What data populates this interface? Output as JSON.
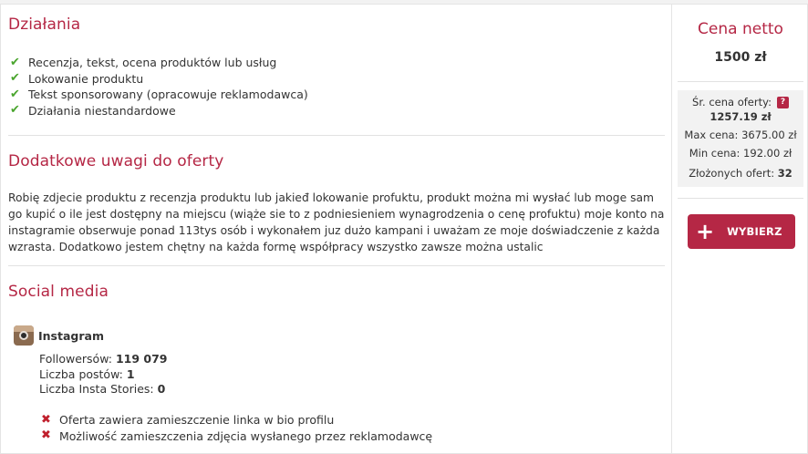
{
  "activities": {
    "title": "Działania",
    "items": [
      "Recenzja, tekst, ocena produktów lub usług",
      "Lokowanie produktu",
      "Tekst sponsorowany (opracowuje reklamodawca)",
      "Działania niestandardowe"
    ]
  },
  "notes": {
    "title": "Dodatkowe uwagi do oferty",
    "text": "Robię zdjecie produktu z recenzja produktu lub jakieđ lokowanie profuktu, produkt można mi wysłać lub moge sam go kupić o ile jest dostępny na miejscu (wiąże sie to z podniesieniem wynagrodzenia o cenę profuktu) moje konto na instagramie obserwuje ponad 113tys osób i  wykonałem juz dużo kampani i uważam ze moje doświadczenie z każda wzrasta. Dodatkowo jestem chętny na każda formę współpracy wszystko zawsze można ustalic"
  },
  "social": {
    "title": "Social media",
    "platform": "Instagram",
    "followers_label": "Followersów:",
    "followers_value": "119 079",
    "posts_label": "Liczba postów:",
    "posts_value": "1",
    "stories_label": "Liczba Insta Stories:",
    "stories_value": "0",
    "excluded": [
      "Oferta zawiera zamieszczenie linka w bio profilu",
      "Możliwość zamieszczenia zdjęcia wysłanego przez reklamodawcę"
    ]
  },
  "sidebar": {
    "price_title": "Cena netto",
    "price_value": "1500 zł",
    "avg_label": "Śr. cena oferty:",
    "help_glyph": "?",
    "avg_value": "1257.19 zł",
    "max_label": "Max cena: 3675.00 zł",
    "min_label": "Min cena: 192.00 zł",
    "offers_label": "Złożonych ofert:",
    "offers_value": "32",
    "button_icon": "+",
    "button_label": "WYBIERZ"
  },
  "colors": {
    "accent": "#b52745",
    "check": "#4aa52e",
    "cross": "#c0202d"
  },
  "icons": {
    "check": "check-icon",
    "cross": "cross-icon",
    "instagram": "instagram-icon",
    "help": "help-icon",
    "plus": "plus-icon"
  }
}
